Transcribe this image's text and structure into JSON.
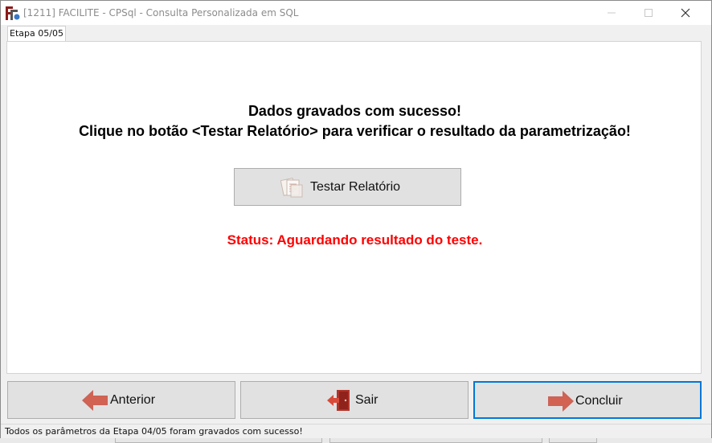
{
  "window": {
    "title": "[1211] FACILITE - CPSql - Consulta Personalizada em SQL"
  },
  "tab": {
    "label": "Etapa 05/05"
  },
  "main": {
    "message_line1": "Dados gravados com sucesso!",
    "message_line2": "Clique no botão <Testar Relatório> para verificar o resultado da parametrização!",
    "test_button_label": "Testar Relatório",
    "status_text": "Status: Aguardando resultado do teste.",
    "status_color": "#ff0000"
  },
  "buttons": {
    "anterior_label": "Anterior",
    "sair_label": "Sair",
    "concluir_label": "Concluir"
  },
  "statusbar": {
    "text": "Todos os parâmetros da Etapa 04/05 foram gravados com sucesso!"
  },
  "icons": {
    "app": "facilite-app-icon",
    "test": "documents-icon",
    "anterior": "arrow-left-icon",
    "sair": "exit-door-icon",
    "concluir": "arrow-right-icon"
  },
  "colors": {
    "accent": "#0078d7",
    "arrow": "#c0392b"
  }
}
